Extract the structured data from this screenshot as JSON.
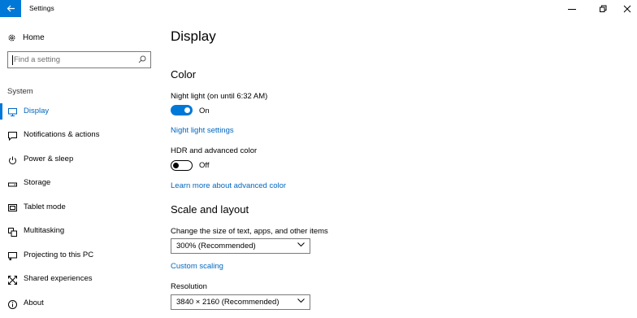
{
  "window": {
    "title": "Settings",
    "back_icon": "arrow-left-icon",
    "accent_color": "#0078d7"
  },
  "sidebar": {
    "home_label": "Home",
    "search_placeholder": "Find a setting",
    "section_label": "System",
    "items": [
      {
        "label": "Display",
        "icon": "monitor-icon",
        "active": true
      },
      {
        "label": "Notifications & actions",
        "icon": "notification-icon",
        "active": false
      },
      {
        "label": "Power & sleep",
        "icon": "power-icon",
        "active": false
      },
      {
        "label": "Storage",
        "icon": "storage-icon",
        "active": false
      },
      {
        "label": "Tablet mode",
        "icon": "tablet-icon",
        "active": false
      },
      {
        "label": "Multitasking",
        "icon": "multitasking-icon",
        "active": false
      },
      {
        "label": "Projecting to this PC",
        "icon": "projecting-icon",
        "active": false
      },
      {
        "label": "Shared experiences",
        "icon": "shared-experiences-icon",
        "active": false
      },
      {
        "label": "About",
        "icon": "info-icon",
        "active": false
      }
    ]
  },
  "main": {
    "page_title": "Display",
    "color_section": {
      "heading": "Color",
      "night_light_label": "Night light (on until 6:32 AM)",
      "night_light_state": "On",
      "night_light_on": true,
      "night_light_settings_link": "Night light settings",
      "hdr_label": "HDR and advanced color",
      "hdr_state": "Off",
      "hdr_on": false,
      "hdr_link": "Learn more about advanced color"
    },
    "scale_section": {
      "heading": "Scale and layout",
      "size_label": "Change the size of text, apps, and other items",
      "size_value": "300% (Recommended)",
      "custom_scaling_link": "Custom scaling",
      "resolution_label": "Resolution",
      "resolution_value": "3840 × 2160 (Recommended)"
    }
  }
}
